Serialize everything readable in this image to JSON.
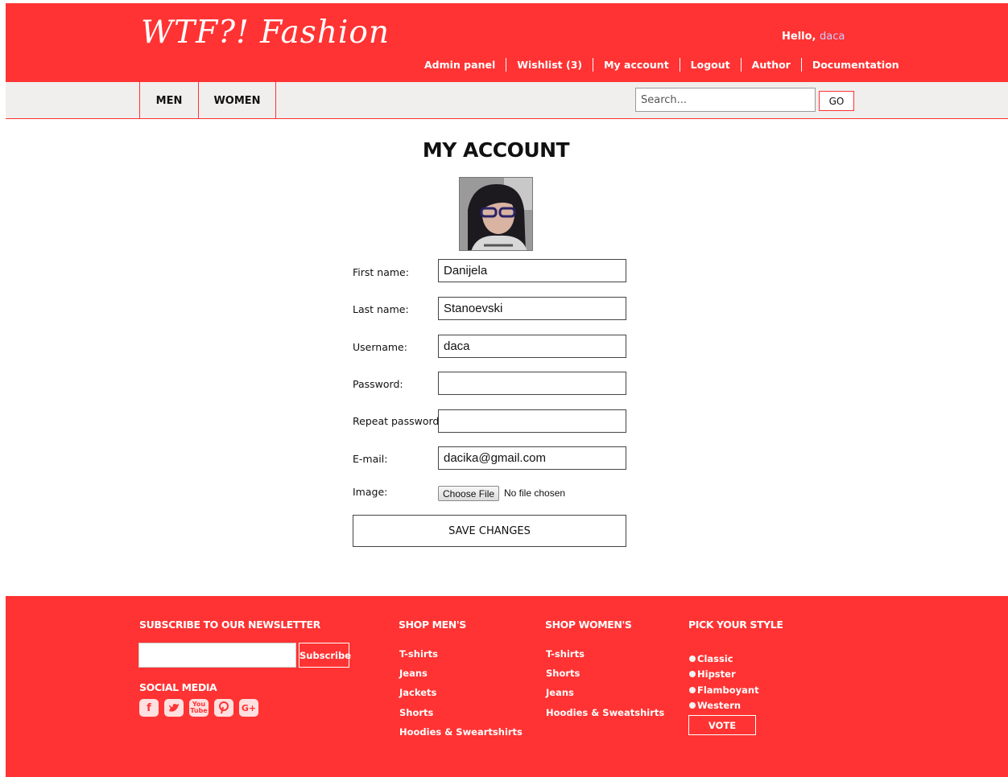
{
  "header": {
    "logo": "WTF?! Fashion",
    "greeting": "Hello,",
    "username": "daca",
    "links": [
      "Admin panel",
      "Wishlist (3)",
      "My account",
      "Logout",
      "Author",
      "Documentation"
    ]
  },
  "nav": {
    "categories": [
      "MEN",
      "WOMEN"
    ],
    "search_placeholder": "Search...",
    "search_button": "GO"
  },
  "account": {
    "title": "MY ACCOUNT",
    "fields": [
      {
        "label": "First name:",
        "value": "Danijela"
      },
      {
        "label": "Last name:",
        "value": "Stanoevski"
      },
      {
        "label": "Username:",
        "value": "daca"
      },
      {
        "label": "Password:",
        "value": ""
      },
      {
        "label": "Repeat password:",
        "value": ""
      },
      {
        "label": "E-mail:",
        "value": "dacika@gmail.com"
      }
    ],
    "image_label": "Image:",
    "file_button": "Choose File",
    "file_status": "No file chosen",
    "save_button": "SAVE CHANGES"
  },
  "footer": {
    "newsletter_title": "SUBSCRIBE TO OUR NEWSLETTER",
    "subscribe_button": "Subscribe",
    "social_title": "SOCIAL MEDIA",
    "social_icons": [
      "facebook-icon",
      "twitter-icon",
      "youtube-icon",
      "pinterest-icon",
      "google-plus-icon"
    ],
    "men_title": "SHOP MEN'S",
    "men_links": [
      "T-shirts",
      "Jeans",
      "Jackets",
      "Shorts",
      "Hoodies & Sweartshirts"
    ],
    "women_title": "SHOP WOMEN'S",
    "women_links": [
      "T-shirts",
      "Shorts",
      "Jeans",
      "Hoodies & Sweatshirts"
    ],
    "style_title": "PICK YOUR STYLE",
    "styles": [
      "Classic",
      "Hipster",
      "Flamboyant",
      "Western"
    ],
    "vote_button": "VOTE"
  },
  "colors": {
    "brand_red": "#ff3333",
    "nav_bg": "#f1efee",
    "username_link": "#c9ccff"
  }
}
